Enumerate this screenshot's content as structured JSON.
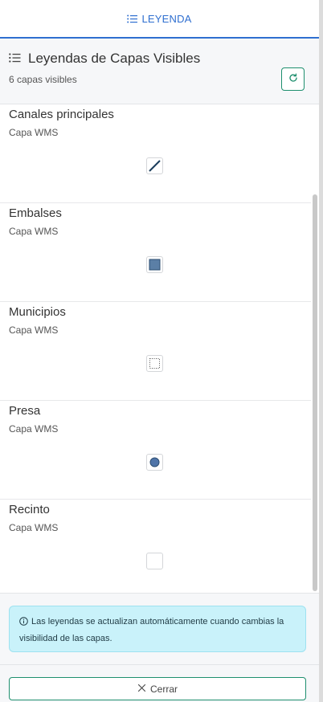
{
  "tab": {
    "label": "LEYENDA",
    "icon": "list-icon",
    "color": "#2f6fd0"
  },
  "header": {
    "title": "Leyendas de Capas Visibles",
    "icon": "list-icon",
    "count": "6 capas visibles",
    "refresh_icon": "refresh-icon"
  },
  "layers": [
    {
      "name": "Canales principales",
      "type": "Capa WMS",
      "symbol": "line-symbol"
    },
    {
      "name": "Embalses",
      "type": "Capa WMS",
      "symbol": "square-fill-symbol"
    },
    {
      "name": "Municipios",
      "type": "Capa WMS",
      "symbol": "dotted-outline-symbol"
    },
    {
      "name": "Presa",
      "type": "Capa WMS",
      "symbol": "circle-symbol"
    },
    {
      "name": "Recinto",
      "type": "Capa WMS",
      "symbol": "empty-symbol"
    }
  ],
  "info": {
    "icon": "info-icon",
    "text": "Las leyendas se actualizan automáticamente cuando cambias la visibilidad de las capas."
  },
  "close_button": {
    "label": "Cerrar",
    "icon": "close-icon"
  },
  "colors": {
    "accent": "#2f6fd0",
    "button_border": "#1e8f6e",
    "info_bg": "#c9f2fa",
    "symbol_fill": "#5b7fa6"
  }
}
